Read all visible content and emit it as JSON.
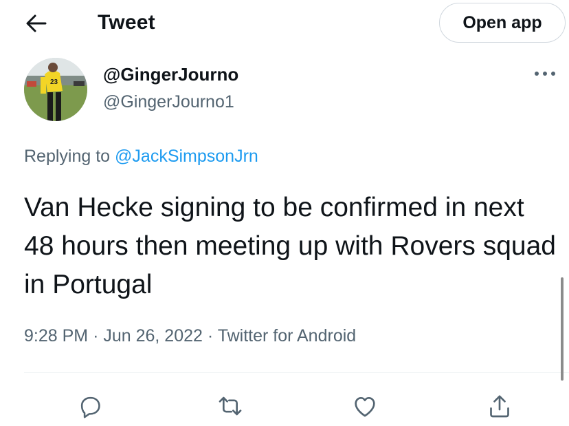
{
  "header": {
    "title": "Tweet",
    "open_app_label": "Open app"
  },
  "author": {
    "display_name": "@GingerJourno",
    "handle": "@GingerJourno1",
    "avatar_jersey_number": "23"
  },
  "reply": {
    "prefix": "Replying to",
    "mention": "@JackSimpsonJrn"
  },
  "tweet": {
    "text": "Van Hecke signing to be confirmed in next 48 hours then meeting up with Rovers squad in Portugal",
    "time": "9:28 PM",
    "date": "Jun 26, 2022",
    "source": "Twitter for Android",
    "separator": "·"
  },
  "colors": {
    "text": "#0f1419",
    "secondary": "#536471",
    "accent": "#1d9bf0",
    "border": "#eff3f4"
  },
  "icons": [
    "back-arrow-icon",
    "more-icon",
    "reply-icon",
    "retweet-icon",
    "like-icon",
    "share-icon"
  ]
}
